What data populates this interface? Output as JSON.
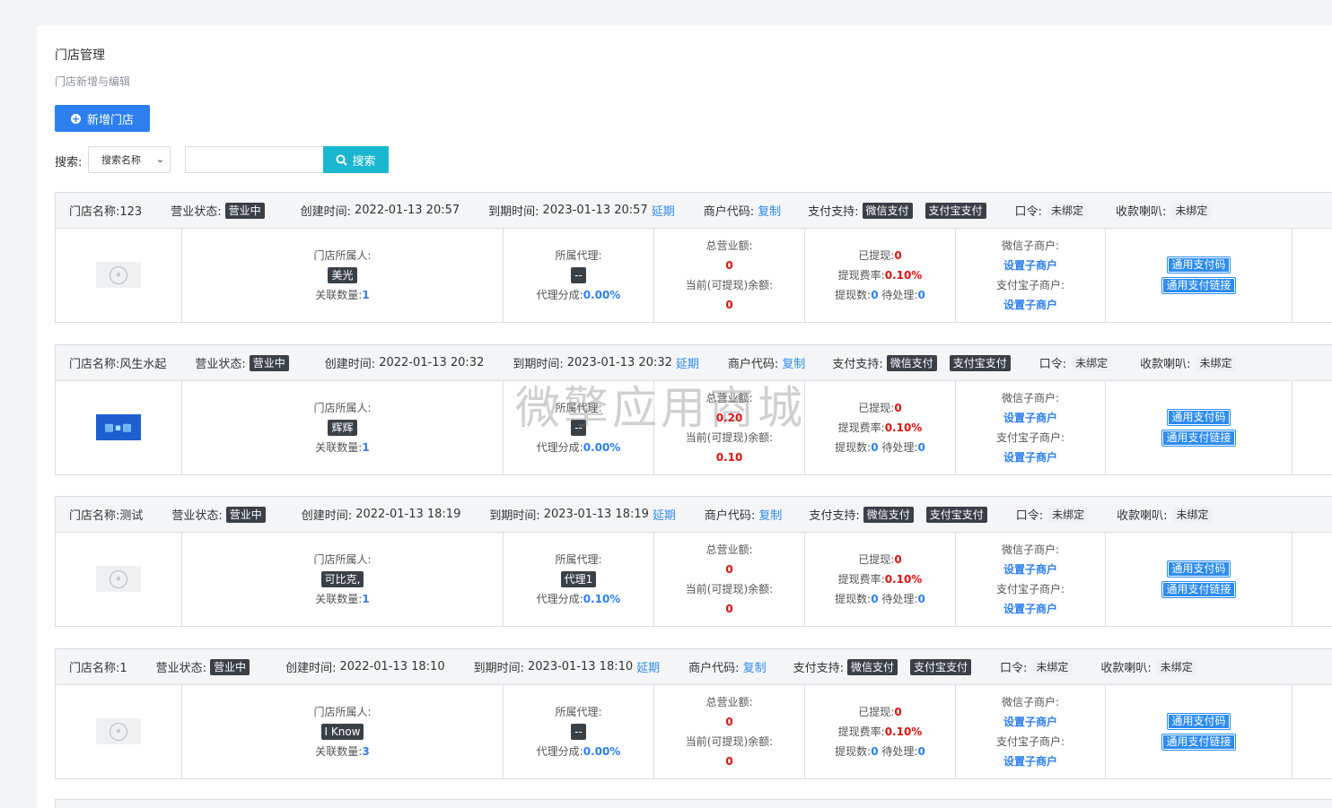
{
  "header": {
    "title": "门店管理",
    "subtitle": "门店新增与编辑"
  },
  "toolbar": {
    "add_label": "新增门店"
  },
  "search": {
    "label": "搜索:",
    "select_value": "搜索名称",
    "input_value": "",
    "button_label": "搜索"
  },
  "labels": {
    "status": "营业状态:",
    "created": "创建时间:",
    "expire": "到期时间:",
    "extend": "延期",
    "merchant_code": "商户代码:",
    "copy": "复制",
    "pay_support": "支付支持:",
    "wechat_pay": "微信支付",
    "alipay": "支付宝支付",
    "password": "口令:",
    "speaker": "收款喇叭:",
    "owner": "门店所属人:",
    "related": "关联数量:",
    "agent": "所属代理:",
    "agent_share": "代理分成:",
    "total_revenue": "总营业额:",
    "balance": "当前(可提现)余额:",
    "withdrawn": "已提现:",
    "fee_rate": "提现费率:",
    "withdraw_count": "提现数:",
    "pending": "待处理:",
    "wx_sub": "微信子商户:",
    "set_sub": "设置子商户",
    "ali_sub": "支付宝子商户:",
    "pay_code": "通用支付码",
    "pay_link": "通用支付链接"
  },
  "stores": [
    {
      "name": "门店名称:123",
      "status": "营业中",
      "created": "2022-01-13 20:57",
      "expire": "2023-01-13 20:57",
      "password": "未绑定",
      "speaker": "未绑定",
      "owner": "美光",
      "related": "1",
      "agent": "--",
      "share": "0.00%",
      "revenue": "0",
      "balance": "0",
      "withdrawn": "0",
      "fee": "0.10%",
      "wcount": "0",
      "pending": "0",
      "logo": "gray"
    },
    {
      "name": "门店名称:风生水起",
      "status": "营业中",
      "created": "2022-01-13 20:32",
      "expire": "2023-01-13 20:32",
      "password": "未绑定",
      "speaker": "未绑定",
      "owner": "辉辉",
      "related": "1",
      "agent": "--",
      "share": "0.00%",
      "revenue": "0.20",
      "balance": "0.10",
      "withdrawn": "0",
      "fee": "0.10%",
      "wcount": "0",
      "pending": "0",
      "logo": "blue"
    },
    {
      "name": "门店名称:测试",
      "status": "营业中",
      "created": "2022-01-13 18:19",
      "expire": "2023-01-13 18:19",
      "password": "未绑定",
      "speaker": "未绑定",
      "owner": "可比克,",
      "related": "1",
      "agent": "代理1",
      "share": "0.10%",
      "revenue": "0",
      "balance": "0",
      "withdrawn": "0",
      "fee": "0.10%",
      "wcount": "0",
      "pending": "0",
      "logo": "gray"
    },
    {
      "name": "门店名称:1",
      "status": "营业中",
      "created": "2022-01-13 18:10",
      "expire": "2023-01-13 18:10",
      "password": "未绑定",
      "speaker": "未绑定",
      "owner": "I Know",
      "related": "3",
      "agent": "--",
      "share": "0.00%",
      "revenue": "0",
      "balance": "0",
      "withdrawn": "0",
      "fee": "0.10%",
      "wcount": "0",
      "pending": "0",
      "logo": "gray"
    }
  ],
  "watermark": "微擎应用商城"
}
